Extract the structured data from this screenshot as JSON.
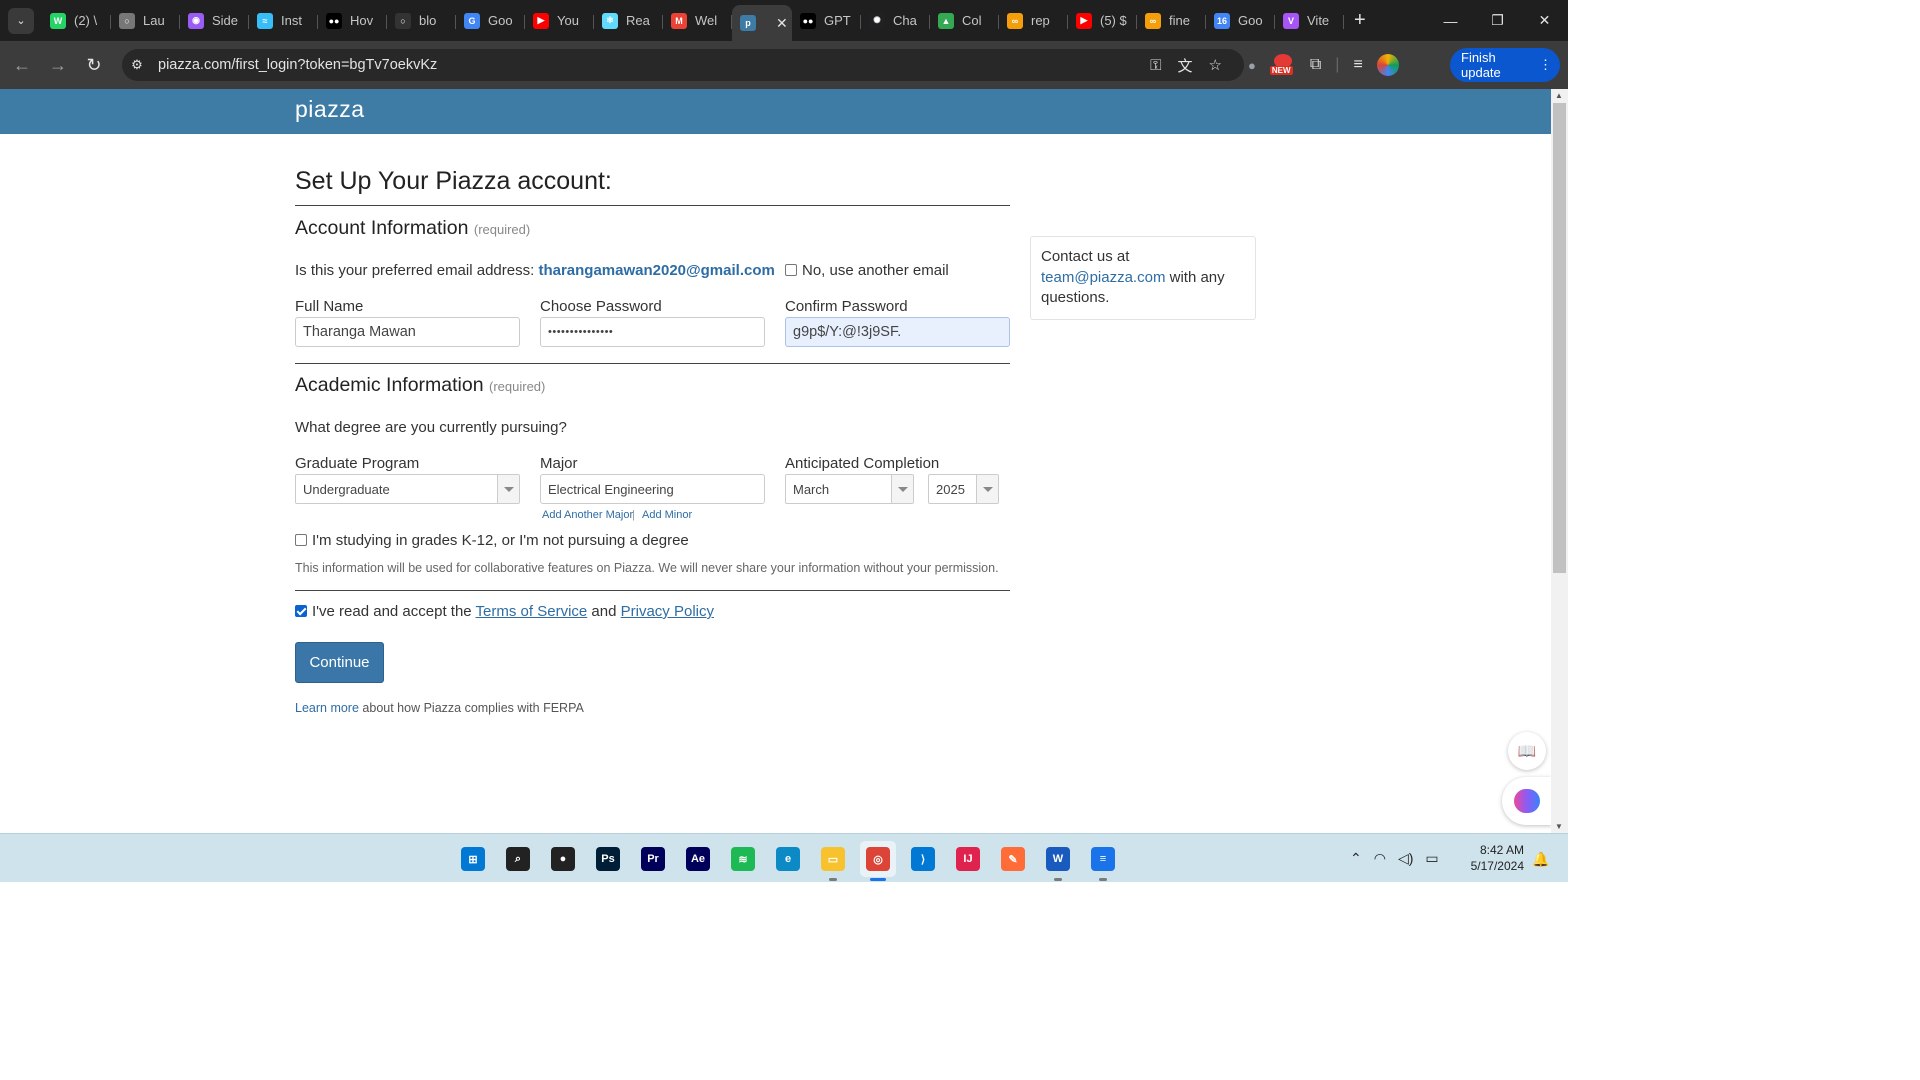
{
  "browser": {
    "tabs": [
      {
        "title": "(2) \\",
        "icon": "whatsapp-icon",
        "color": "#25d366",
        "glyph": "W"
      },
      {
        "title": "Lau",
        "icon": "globe-icon",
        "color": "#777777",
        "glyph": "○"
      },
      {
        "title": "Side",
        "icon": "sider-brain-icon",
        "color": "#9b5cf6",
        "glyph": "◉"
      },
      {
        "title": "Inst",
        "icon": "tailwind-icon",
        "color": "#38bdf8",
        "glyph": "≈"
      },
      {
        "title": "Hov",
        "icon": "medium-icon",
        "color": "#000000",
        "glyph": "●●"
      },
      {
        "title": "blo",
        "icon": "github-icon",
        "color": "#333333",
        "glyph": "○"
      },
      {
        "title": "Goo",
        "icon": "google-translate-icon",
        "color": "#4285f4",
        "glyph": "G"
      },
      {
        "title": "You",
        "icon": "youtube-icon",
        "color": "#ff0000",
        "glyph": "▶"
      },
      {
        "title": "Rea",
        "icon": "react-icon",
        "color": "#61dafb",
        "glyph": "⚛"
      },
      {
        "title": "Wel",
        "icon": "gmail-icon",
        "color": "#ea4335",
        "glyph": "M"
      },
      {
        "title": "",
        "icon": "piazza-icon",
        "color": "#3e7ca6",
        "glyph": "p",
        "active": true
      },
      {
        "title": "GPT",
        "icon": "medium-icon",
        "color": "#000000",
        "glyph": "●●"
      },
      {
        "title": "Cha",
        "icon": "chatgpt-icon",
        "color": "#202123",
        "glyph": "✺"
      },
      {
        "title": "Col",
        "icon": "google-drive-icon",
        "color": "#34a853",
        "glyph": "▲"
      },
      {
        "title": "rep",
        "icon": "infinity-icon",
        "color": "#f59e0b",
        "glyph": "∞"
      },
      {
        "title": "(5) $",
        "icon": "youtube-icon",
        "color": "#ff0000",
        "glyph": "▶"
      },
      {
        "title": "fine",
        "icon": "infinity-icon",
        "color": "#f59e0b",
        "glyph": "∞"
      },
      {
        "title": "Goo",
        "icon": "google-calendar-icon",
        "color": "#4285f4",
        "glyph": "16"
      },
      {
        "title": "Vite",
        "icon": "vite-icon",
        "color": "#a855f7",
        "glyph": "V"
      }
    ],
    "url": "piazza.com/first_login?token=bgTv7oekvKz",
    "finish_update": "Finish update",
    "new_badge": "NEW"
  },
  "piazza": {
    "logo": "piazza",
    "heading": "Set Up Your Piazza account:",
    "account_section": {
      "title": "Account Information",
      "required": "(required)",
      "email_question": "Is this your preferred email address:",
      "email": "tharangamawan2020@gmail.com",
      "other_email_label": "No, use another email",
      "full_name_label": "Full Name",
      "full_name_value": "Tharanga Mawan",
      "password_label": "Choose Password",
      "password_masked": "•••••••••••••••",
      "confirm_label": "Confirm Password",
      "confirm_value": "g9p$/Y:@!3j9SF."
    },
    "academic_section": {
      "title": "Academic Information",
      "required": "(required)",
      "degree_question": "What degree are you currently pursuing?",
      "program_label": "Graduate Program",
      "program_value": "Undergraduate",
      "major_label": "Major",
      "major_value": "Electrical Engineering",
      "add_major": "Add Another Major",
      "separator": "|",
      "add_minor": "Add Minor",
      "completion_label": "Anticipated Completion",
      "month_value": "March",
      "year_value": "2025",
      "k12_label": "I'm studying in grades K-12, or I'm not pursuing a degree",
      "privacy_note": "This information will be used for collaborative features on Piazza. We will never share your information without your permission."
    },
    "terms": {
      "prefix": "I've read and accept the",
      "tos": "Terms of Service",
      "and": "and",
      "privacy": "Privacy Policy"
    },
    "continue_label": "Continue",
    "ferpa": {
      "link": "Learn more",
      "text": "about how Piazza complies with FERPA"
    },
    "contact": {
      "prefix": "Contact us at",
      "email": "team@piazza.com",
      "suffix": "with any questions."
    }
  },
  "taskbar": {
    "apps": [
      {
        "name": "start-icon",
        "glyph": "⊞",
        "color": "#0078d4"
      },
      {
        "name": "search-icon",
        "glyph": "⌕",
        "color": "#222222"
      },
      {
        "name": "alienware-icon",
        "glyph": "●",
        "color": "#222222"
      },
      {
        "name": "photoshop-icon",
        "glyph": "Ps",
        "color": "#001e36"
      },
      {
        "name": "premiere-icon",
        "glyph": "Pr",
        "color": "#00005b"
      },
      {
        "name": "after-effects-icon",
        "glyph": "Ae",
        "color": "#00005b"
      },
      {
        "name": "spotify-icon",
        "glyph": "≋",
        "color": "#1db954"
      },
      {
        "name": "edge-icon",
        "glyph": "e",
        "color": "#0c8ac6"
      },
      {
        "name": "file-explorer-icon",
        "glyph": "▭",
        "color": "#f8c22e"
      },
      {
        "name": "chrome-icon",
        "glyph": "◎",
        "color": "#db4437"
      },
      {
        "name": "vscode-icon",
        "glyph": "⟩",
        "color": "#0078d4"
      },
      {
        "name": "intellij-icon",
        "glyph": "IJ",
        "color": "#e0234e"
      },
      {
        "name": "postman-icon",
        "glyph": "✎",
        "color": "#ff6c37"
      },
      {
        "name": "word-icon",
        "glyph": "W",
        "color": "#185abd"
      },
      {
        "name": "notepad-icon",
        "glyph": "≡",
        "color": "#1a73e8"
      }
    ],
    "time": "8:42 AM",
    "date": "5/17/2024"
  }
}
